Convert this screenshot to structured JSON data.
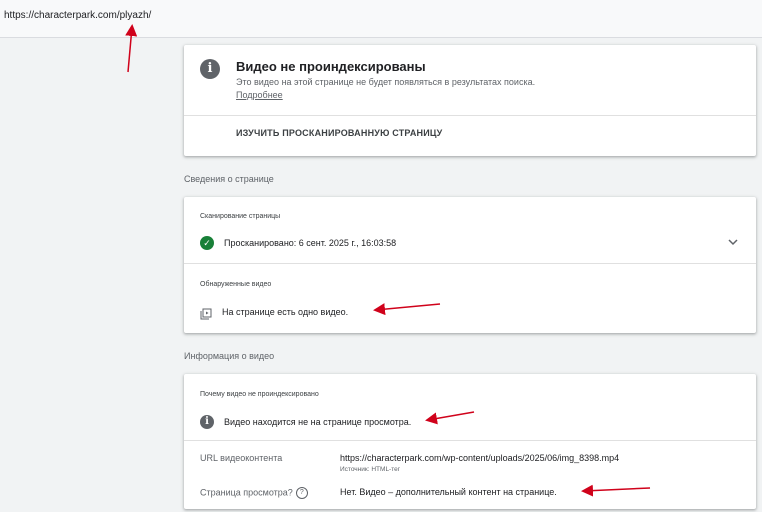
{
  "url_bar": {
    "text": "https://characterpark.com/plyazh/"
  },
  "status_card": {
    "title": "Видео не проиндексированы",
    "description": "Это видео на этой странице не будет появляться в результатах поиска.",
    "learn_more": "Подробнее",
    "action": "ИЗУЧИТЬ ПРОСКАНИРОВАННУЮ СТРАНИЦУ"
  },
  "page_info": {
    "section_title": "Сведения о странице",
    "crawl_label": "Сканирование страницы",
    "crawl_status": "Просканировано: 6 сент. 2025 г., 16:03:58",
    "videos_label": "Обнаруженные видео",
    "videos_text": "На странице есть одно видео."
  },
  "video_info": {
    "section_title": "Информация о видео",
    "reason_label": "Почему видео не проиндексировано",
    "reason_text": "Видео находится не на странице просмотра.",
    "url_label": "URL видеоконтента",
    "url_value": "https://characterpark.com/wp-content/uploads/2025/06/img_8398.mp4",
    "url_source": "Источник: HTML-тег",
    "watch_label": "Страница просмотра?",
    "watch_value": "Нет. Видео – дополнительный контент на странице."
  },
  "icons": {
    "info": "info-icon",
    "check": "check-circle-icon",
    "chevron": "chevron-down-icon",
    "video": "video-library-icon",
    "help": "help-icon"
  },
  "colors": {
    "success": "#188038",
    "annotation": "#d0021b",
    "icon_grey": "#5f6368"
  }
}
